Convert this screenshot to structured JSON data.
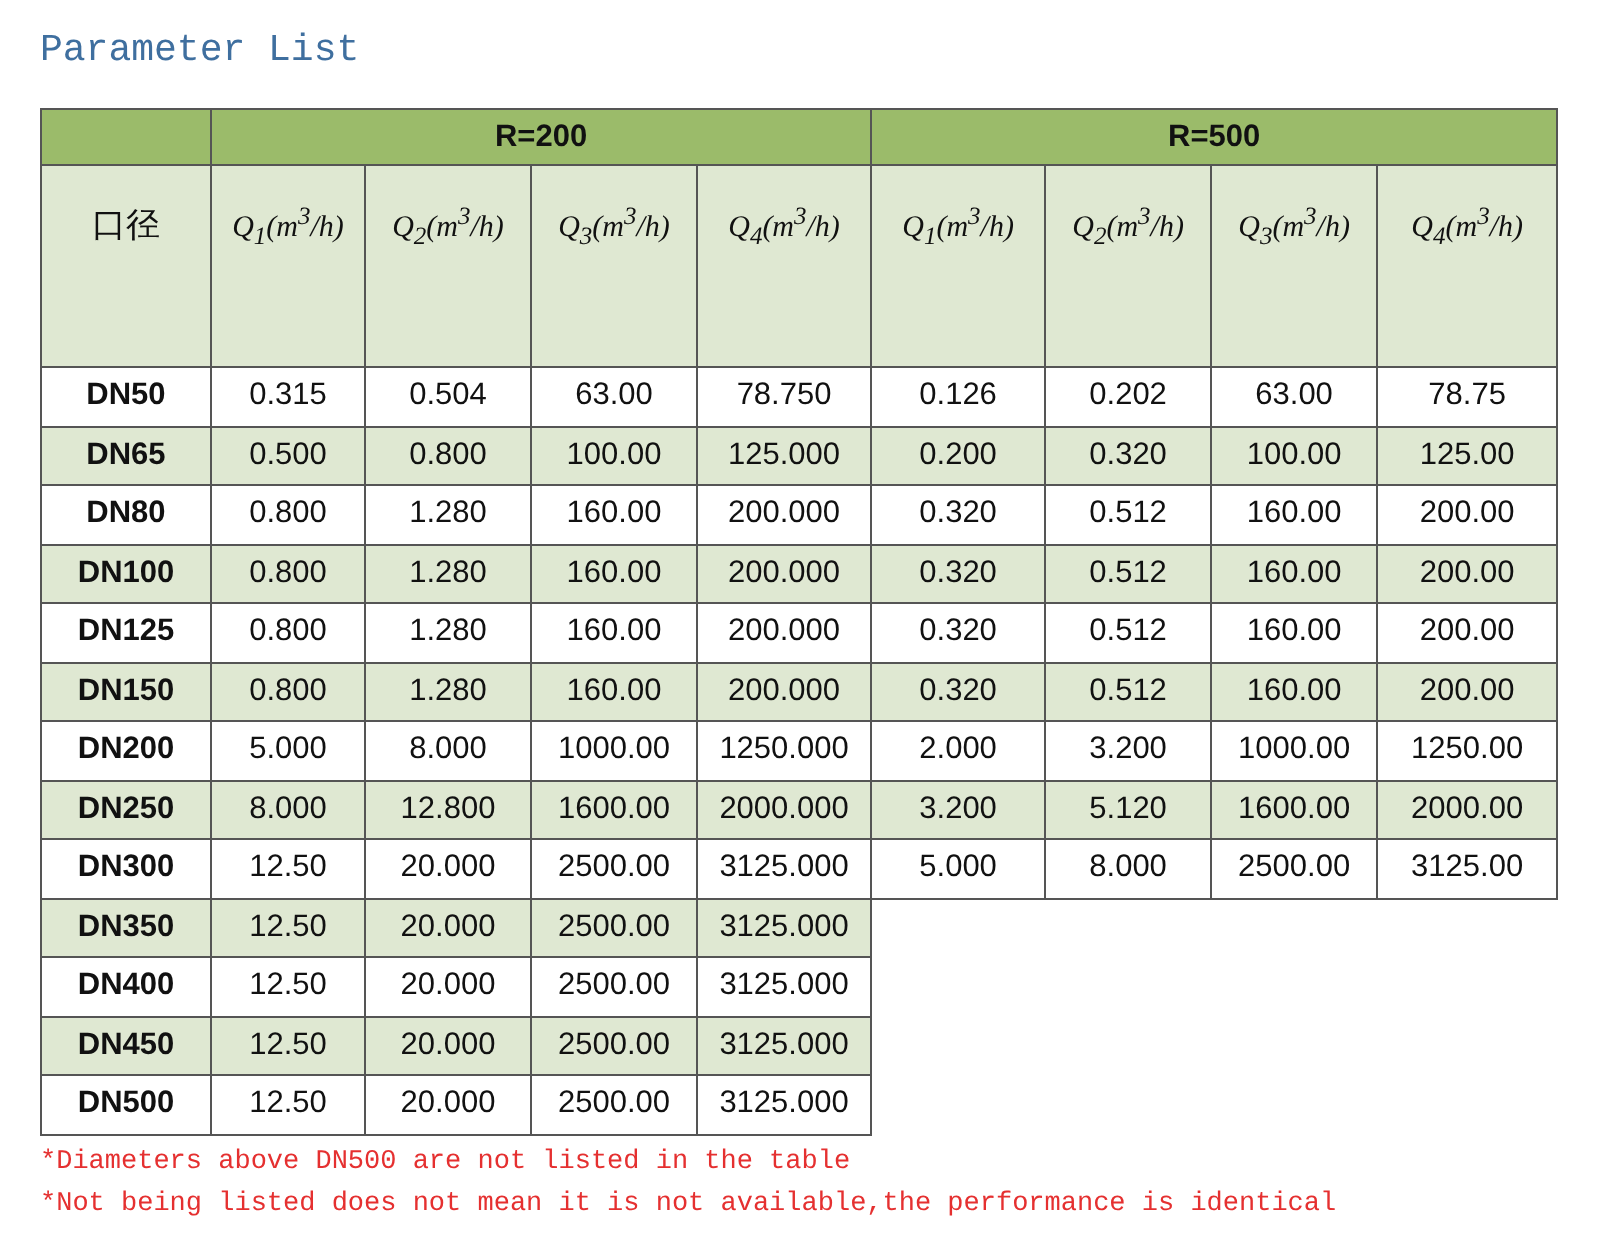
{
  "title": "Parameter List",
  "table": {
    "groups": [
      "R=200",
      "R=500"
    ],
    "header_label": "口径",
    "columns": [
      "Q$_{1}$(m$^{3}$/h)",
      "Q$_{2}$(m$^{3}$/h)",
      "Q$_{3}$(m$^{3}$/h)",
      "Q$_{4}$(m$^{3}$/h)",
      "Q$_{1}$(m$^{3}$/h)",
      "Q$_{2}$(m$^{3}$/h)",
      "Q$_{3}$(m$^{3}$/h)",
      "Q$_{4}$(m$^{3}$/h)"
    ],
    "rows": [
      {
        "size": "DN50",
        "values": [
          "0.315",
          "0.504",
          "63.00",
          "78.750",
          "0.126",
          "0.202",
          "63.00",
          "78.75"
        ]
      },
      {
        "size": "DN65",
        "values": [
          "0.500",
          "0.800",
          "100.00",
          "125.000",
          "0.200",
          "0.320",
          "100.00",
          "125.00"
        ]
      },
      {
        "size": "DN80",
        "values": [
          "0.800",
          "1.280",
          "160.00",
          "200.000",
          "0.320",
          "0.512",
          "160.00",
          "200.00"
        ]
      },
      {
        "size": "DN100",
        "values": [
          "0.800",
          "1.280",
          "160.00",
          "200.000",
          "0.320",
          "0.512",
          "160.00",
          "200.00"
        ]
      },
      {
        "size": "DN125",
        "values": [
          "0.800",
          "1.280",
          "160.00",
          "200.000",
          "0.320",
          "0.512",
          "160.00",
          "200.00"
        ]
      },
      {
        "size": "DN150",
        "values": [
          "0.800",
          "1.280",
          "160.00",
          "200.000",
          "0.320",
          "0.512",
          "160.00",
          "200.00"
        ]
      },
      {
        "size": "DN200",
        "values": [
          "5.000",
          "8.000",
          "1000.00",
          "1250.000",
          "2.000",
          "3.200",
          "1000.00",
          "1250.00"
        ]
      },
      {
        "size": "DN250",
        "values": [
          "8.000",
          "12.800",
          "1600.00",
          "2000.000",
          "3.200",
          "5.120",
          "1600.00",
          "2000.00"
        ]
      },
      {
        "size": "DN300",
        "values": [
          "12.50",
          "20.000",
          "2500.00",
          "3125.000",
          "5.000",
          "8.000",
          "2500.00",
          "3125.00"
        ]
      },
      {
        "size": "DN350",
        "values": [
          "12.50",
          "20.000",
          "2500.00",
          "3125.000"
        ]
      },
      {
        "size": "DN400",
        "values": [
          "12.50",
          "20.000",
          "2500.00",
          "3125.000"
        ]
      },
      {
        "size": "DN450",
        "values": [
          "12.50",
          "20.000",
          "2500.00",
          "3125.000"
        ]
      },
      {
        "size": "DN500",
        "values": [
          "12.50",
          "20.000",
          "2500.00",
          "3125.000"
        ]
      }
    ]
  },
  "notes": [
    "*Diameters above DN500 are not listed in the table",
    "*Not being listed does not mean it is not available,the performance is identical"
  ]
}
